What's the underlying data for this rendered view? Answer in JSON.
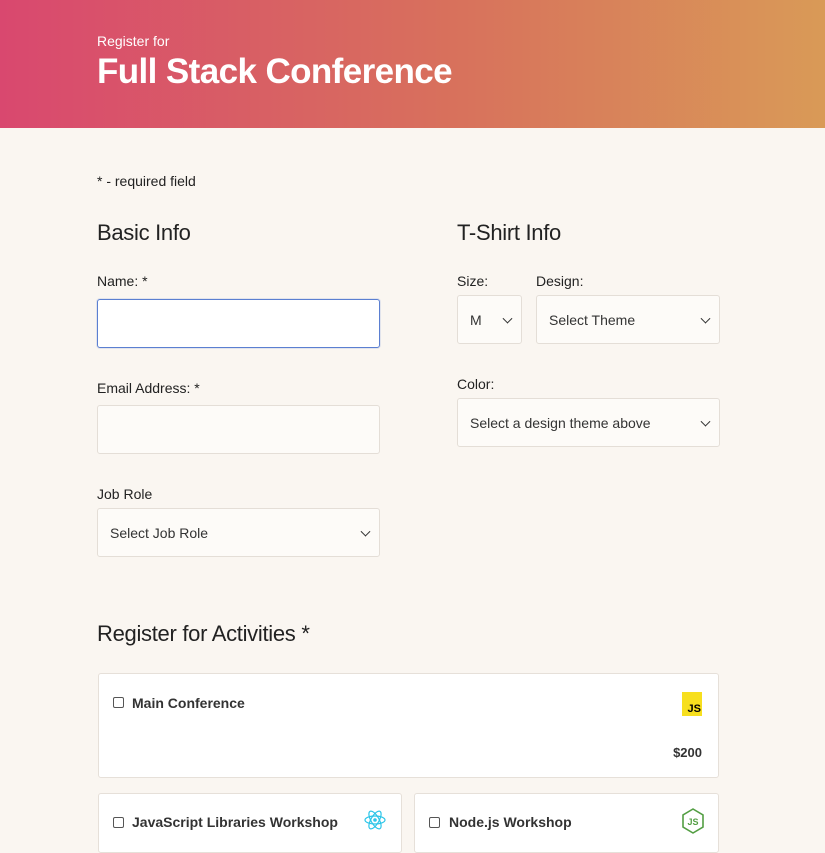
{
  "header": {
    "pretitle": "Register for",
    "title": "Full Stack Conference"
  },
  "required_note": "* - required field",
  "basic_info": {
    "heading": "Basic Info",
    "name_label": "Name: *",
    "name_value": "",
    "email_label": "Email Address: *",
    "email_value": "",
    "job_label": "Job Role",
    "job_value": "Select Job Role"
  },
  "tshirt": {
    "heading": "T-Shirt Info",
    "size_label": "Size:",
    "size_value": "M",
    "design_label": "Design:",
    "design_value": "Select Theme",
    "color_label": "Color:",
    "color_value": "Select a design theme above"
  },
  "activities": {
    "heading": "Register for Activities *",
    "items": [
      {
        "name": "Main Conference",
        "price": "$200",
        "icon": "javascript-icon"
      },
      {
        "name": "JavaScript Libraries Workshop",
        "icon": "react-icon"
      },
      {
        "name": "Node.js Workshop",
        "icon": "nodejs-icon"
      }
    ]
  },
  "colors": {
    "header_start": "#d9486f",
    "header_end": "#d99a57",
    "page_background": "#faf6f1",
    "focus_border": "#5b7fd1"
  }
}
